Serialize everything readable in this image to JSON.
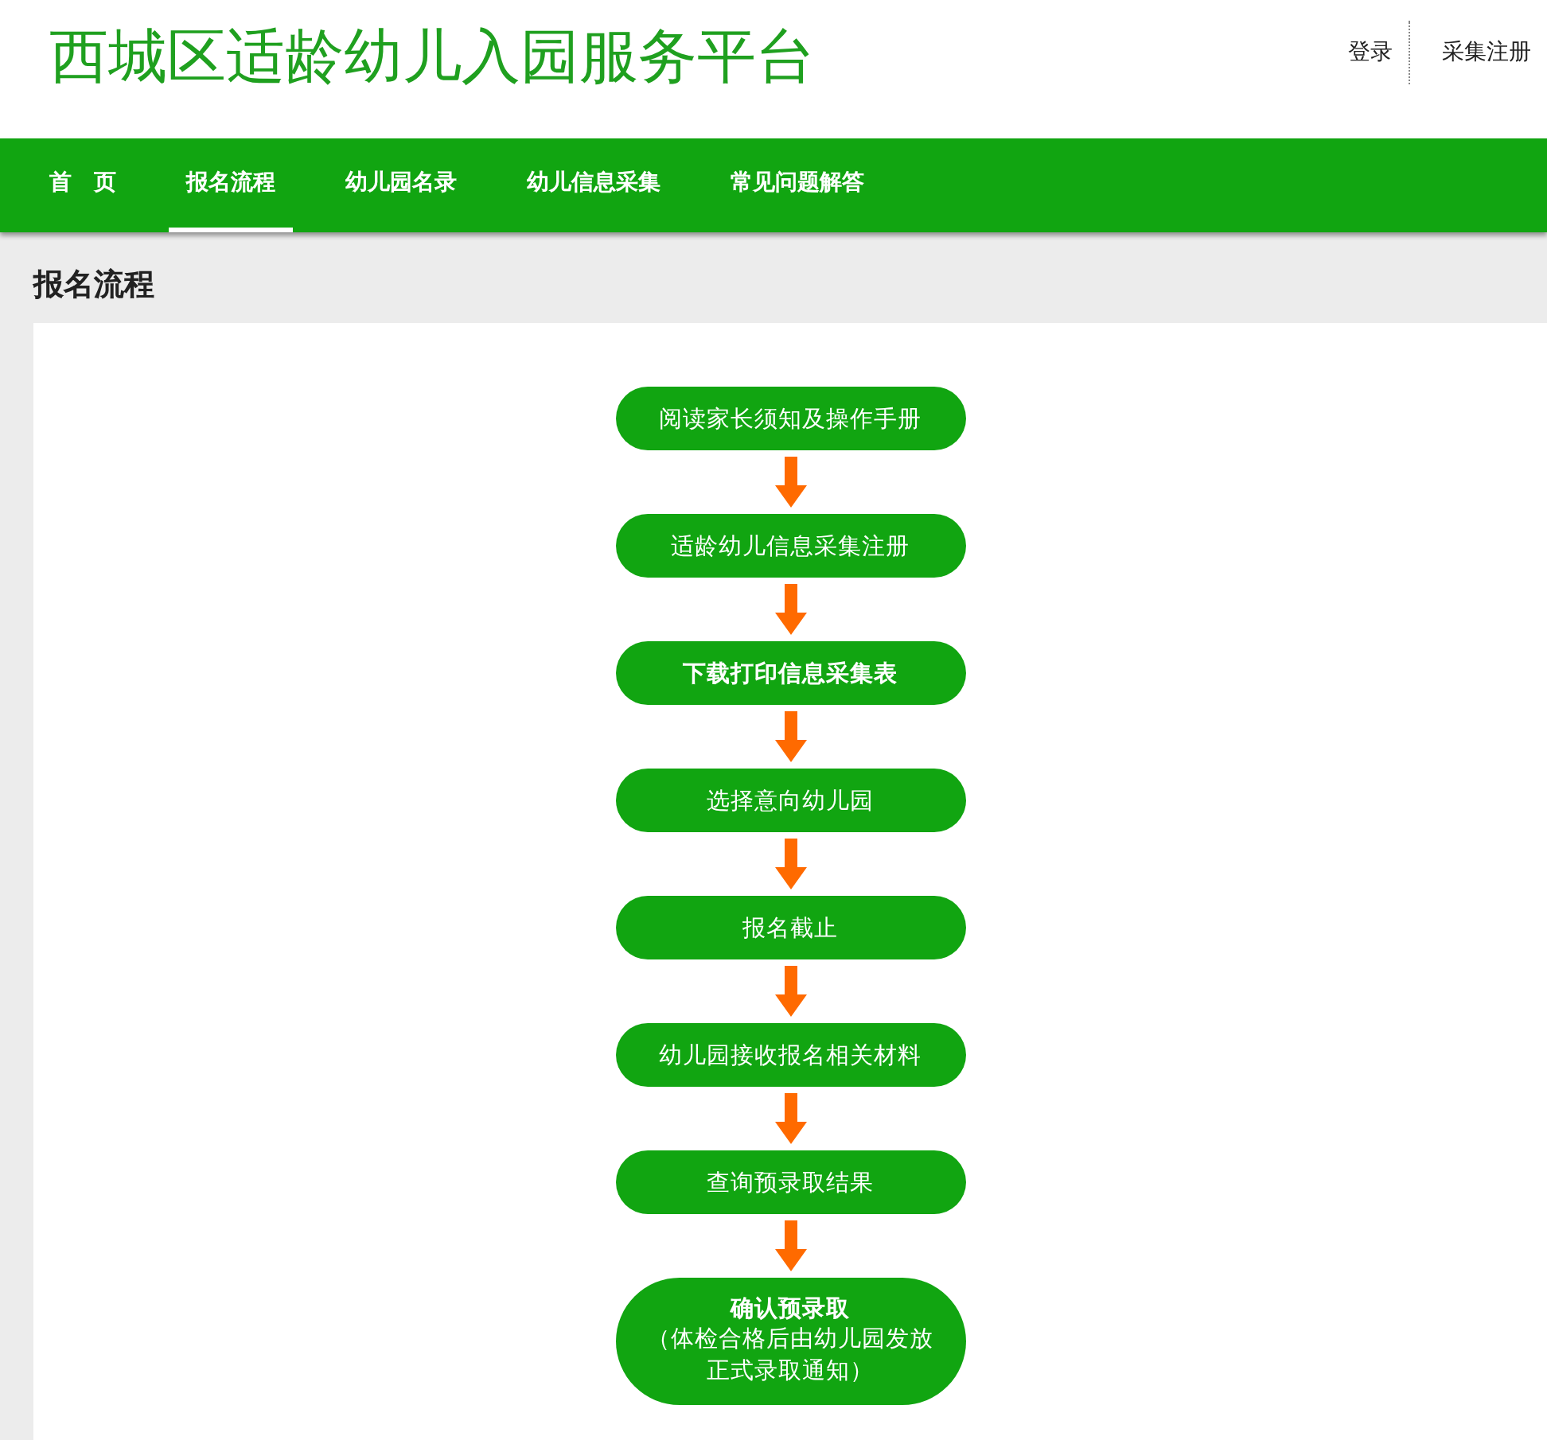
{
  "site_title": "西城区适龄幼儿入园服务平台",
  "header_links": [
    "登录",
    "采集注册"
  ],
  "nav": [
    {
      "label": "首　页",
      "selected": false
    },
    {
      "label": "报名流程",
      "selected": true
    },
    {
      "label": "幼儿园名录",
      "selected": false
    },
    {
      "label": "幼儿信息采集",
      "selected": false
    },
    {
      "label": "常见问题解答",
      "selected": false
    }
  ],
  "page_heading": "报名流程",
  "steps": [
    {
      "kind": "plain",
      "text": "阅读家长须知及操作手册"
    },
    {
      "kind": "plain",
      "text": "适龄幼儿信息采集注册"
    },
    {
      "kind": "emphasis",
      "text": "下载打印信息采集表"
    },
    {
      "kind": "plain",
      "text": "选择意向幼儿园"
    },
    {
      "kind": "plain",
      "text": "报名截止"
    },
    {
      "kind": "plain",
      "text": "幼儿园接收报名相关材料"
    },
    {
      "kind": "plain",
      "text": "查询预录取结果"
    },
    {
      "kind": "final",
      "text": "确认预录取",
      "note": "（体检合格后由幼儿园发放正式录取通知）"
    }
  ]
}
